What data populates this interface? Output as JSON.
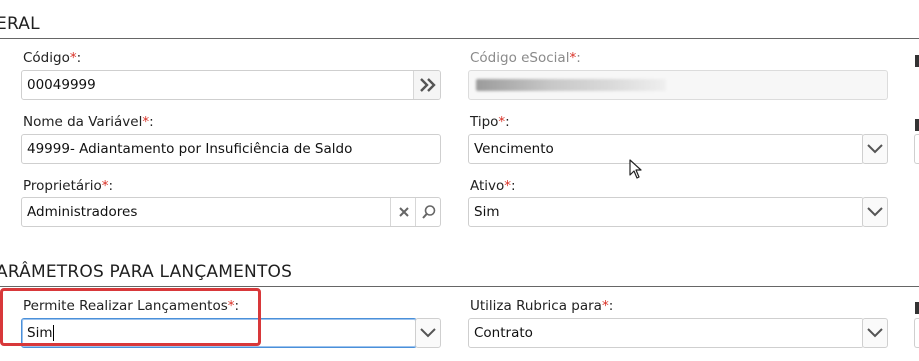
{
  "sections": {
    "general_title": "ERAL",
    "params_title": "ARÂMETROS PARA LANÇAMENTOS"
  },
  "required_mark": "*",
  "fields": {
    "codigo": {
      "label": "Código",
      "value": "00049999"
    },
    "codigo_esocial": {
      "label": "Código eSocial",
      "value": ""
    },
    "nome_variavel": {
      "label": "Nome da Variável",
      "value": "49999- Adiantamento por Insuficiência de Saldo"
    },
    "tipo": {
      "label": "Tipo",
      "value": "Vencimento"
    },
    "proprietario": {
      "label": "Proprietário",
      "value": "Administradores"
    },
    "ativo": {
      "label": "Ativo",
      "value": "Sim"
    },
    "permite_lancamentos": {
      "label": "Permite Realizar Lançamentos",
      "value": "Sim"
    },
    "utiliza_rubrica": {
      "label": "Utiliza Rubrica para",
      "value": "Contrato"
    }
  },
  "colors": {
    "required": "#d93025",
    "highlight": "#d8383a",
    "focus_border": "#4a90d9"
  }
}
